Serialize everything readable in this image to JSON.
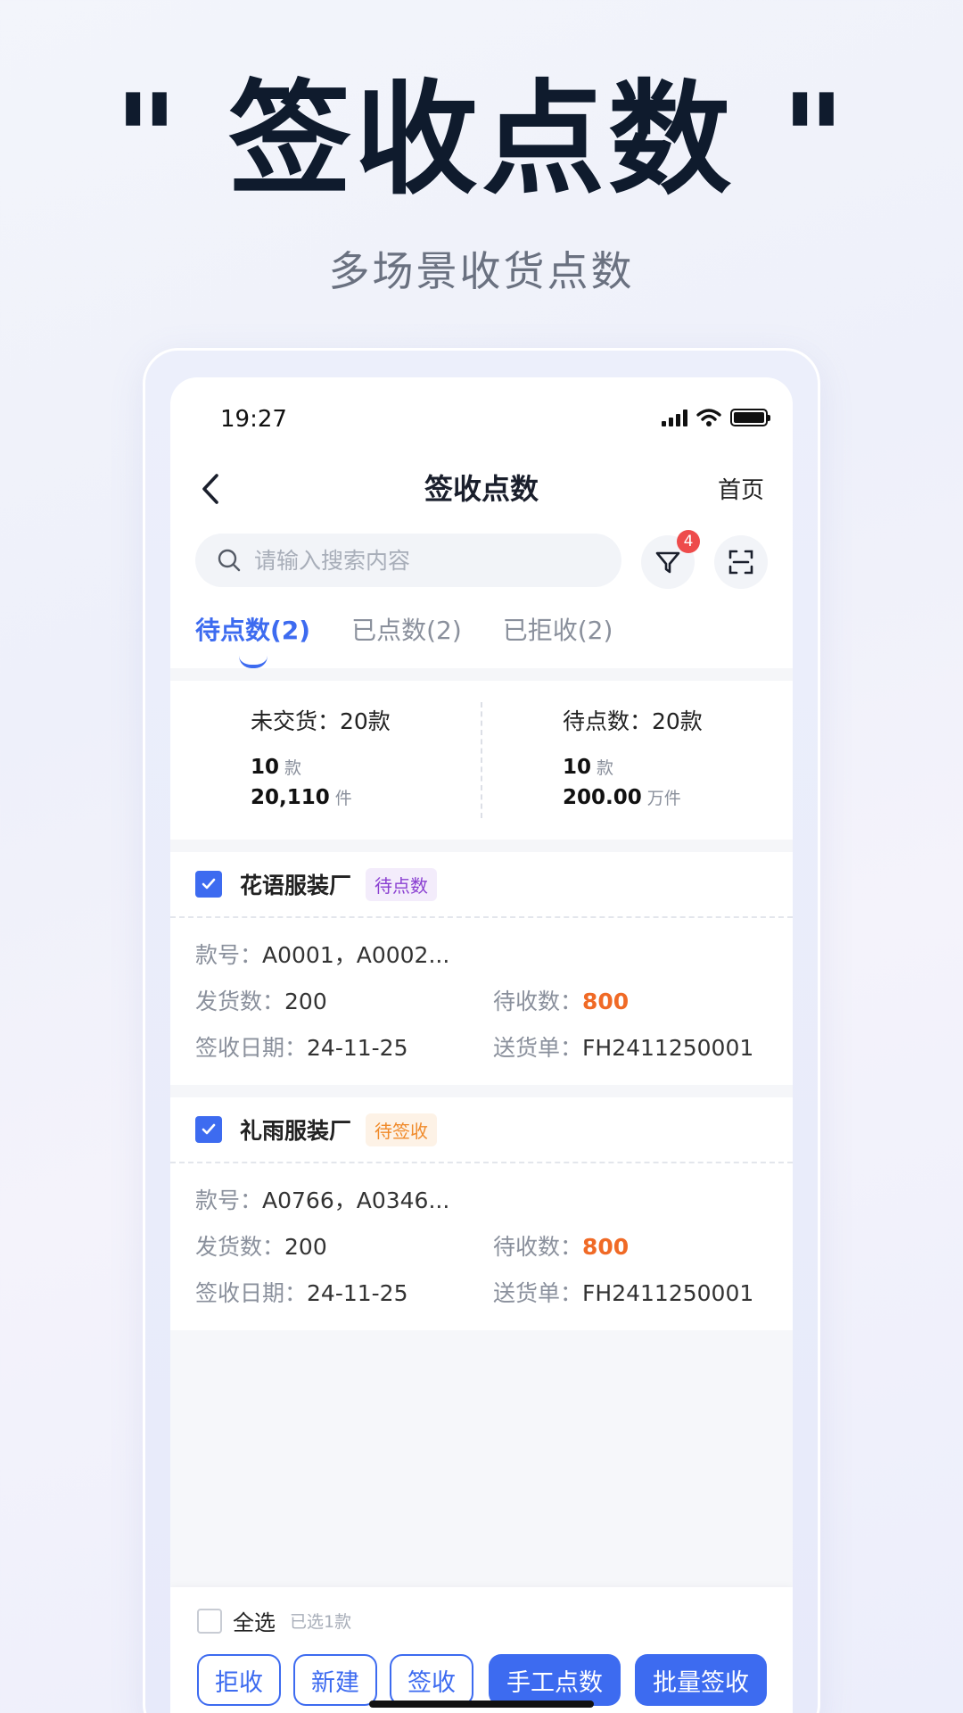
{
  "hero": {
    "title": "\" 签收点数 \"",
    "subtitle": "多场景收货点数"
  },
  "status_bar": {
    "time": "19:27"
  },
  "nav": {
    "title": "签收点数",
    "home_label": "首页"
  },
  "search": {
    "placeholder": "请输入搜索内容"
  },
  "filter": {
    "badge_count": "4"
  },
  "tabs": [
    {
      "label": "待点数(2)",
      "active": true
    },
    {
      "label": "已点数(2)",
      "active": false
    },
    {
      "label": "已拒收(2)",
      "active": false
    }
  ],
  "summary": {
    "left": {
      "heading": "未交货：20款",
      "styles_value": "10",
      "styles_unit": "款",
      "pieces_value": "20,110",
      "pieces_unit": "件"
    },
    "right": {
      "heading": "待点数：20款",
      "styles_value": "10",
      "styles_unit": "款",
      "pieces_value": "200.00",
      "pieces_unit": "万件"
    }
  },
  "cards": [
    {
      "company": "花语服装厂",
      "tag": "待点数",
      "style_label": "款号：",
      "style_value": "A0001，A0002...",
      "shipped_label": "发货数：",
      "shipped_value": "200",
      "pending_label": "待收数：",
      "pending_value": "800",
      "date_label": "签收日期：",
      "date_value": "24-11-25",
      "delivery_label": "送货单：",
      "delivery_value": "FH2411250001"
    },
    {
      "company": "礼雨服装厂",
      "tag": "待签收",
      "style_label": "款号：",
      "style_value": "A0766，A0346...",
      "shipped_label": "发货数：",
      "shipped_value": "200",
      "pending_label": "待收数：",
      "pending_value": "800",
      "date_label": "签收日期：",
      "date_value": "24-11-25",
      "delivery_label": "送货单：",
      "delivery_value": "FH2411250001"
    }
  ],
  "bottom": {
    "select_all": "全选",
    "selected_count": "已选1款",
    "buttons": {
      "reject": "拒收",
      "create": "新建",
      "sign": "签收",
      "manual_count": "手工点数",
      "batch_sign": "批量签收"
    }
  },
  "colors": {
    "accent": "#3d6bf0",
    "highlight": "#f06a26",
    "badge": "#ee4b4b",
    "tag_purple": "#8a3fd1",
    "tag_orange": "#f08a2a"
  },
  "icons": [
    "chevron-left-icon",
    "search-icon",
    "filter-icon",
    "scan-icon",
    "checkbox-checked-icon",
    "signal-icon",
    "wifi-icon",
    "battery-icon"
  ]
}
